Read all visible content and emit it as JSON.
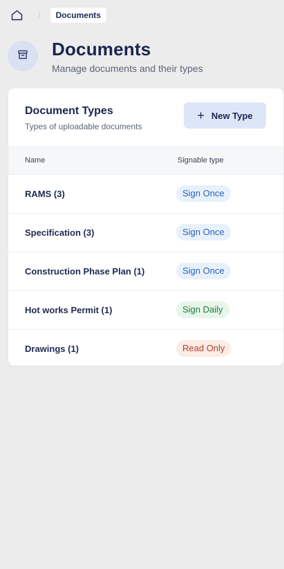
{
  "breadcrumb": {
    "home_icon": "home-icon",
    "current": "Documents"
  },
  "header": {
    "icon": "archive-box-icon",
    "title": "Documents",
    "subtitle": "Manage documents and their types"
  },
  "card": {
    "title": "Document Types",
    "subtitle": "Types of uploadable documents",
    "new_button_label": "New Type",
    "columns": {
      "name": "Name",
      "signable": "Signable type"
    },
    "rows": [
      {
        "name": "RAMS (3)",
        "signable": "Sign Once",
        "variant": "once"
      },
      {
        "name": "Specification (3)",
        "signable": "Sign Once",
        "variant": "once"
      },
      {
        "name": "Construction Phase Plan (1)",
        "signable": "Sign Once",
        "variant": "once"
      },
      {
        "name": "Hot works Permit (1)",
        "signable": "Sign Daily",
        "variant": "daily"
      },
      {
        "name": "Drawings (1)",
        "signable": "Read Only",
        "variant": "read"
      }
    ]
  },
  "colors": {
    "page_bg": "#ececec",
    "accent_bg": "#dde6f7",
    "sign_once": "#2a63b8",
    "sign_daily": "#257a3c",
    "read_only": "#b3402a"
  }
}
